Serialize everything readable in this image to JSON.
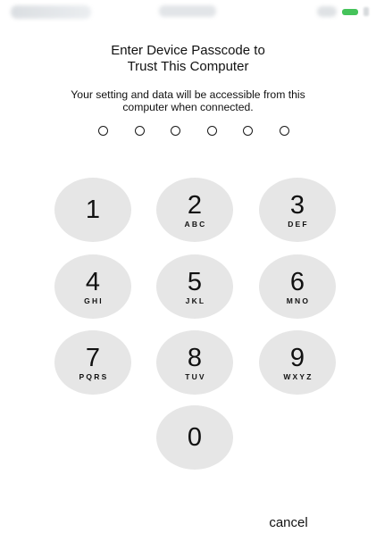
{
  "header": {
    "title_line1": "Enter Device Passcode to",
    "title_line2": "Trust This Computer",
    "subtitle_line1": "Your setting and data will be accessible from this",
    "subtitle_line2": "computer when connected."
  },
  "passcode": {
    "length": 6,
    "entered": 0
  },
  "keypad": {
    "keys": [
      {
        "digit": "1",
        "letters": ""
      },
      {
        "digit": "2",
        "letters": "ABC"
      },
      {
        "digit": "3",
        "letters": "DEF"
      },
      {
        "digit": "4",
        "letters": "GHI"
      },
      {
        "digit": "5",
        "letters": "JKL"
      },
      {
        "digit": "6",
        "letters": "MNO"
      },
      {
        "digit": "7",
        "letters": "PQRS"
      },
      {
        "digit": "8",
        "letters": "TUV"
      },
      {
        "digit": "9",
        "letters": "WXYZ"
      },
      {
        "digit": "0",
        "letters": ""
      }
    ]
  },
  "actions": {
    "cancel_label": "cancel"
  },
  "status_bar": {
    "icons": [
      "cellular-signal-icon",
      "wifi-icon",
      "clock-time",
      "location-icon",
      "battery-icon"
    ]
  },
  "colors": {
    "key_background": "#e6e6e6",
    "text": "#111111",
    "battery": "#45c35a",
    "background": "#ffffff"
  }
}
